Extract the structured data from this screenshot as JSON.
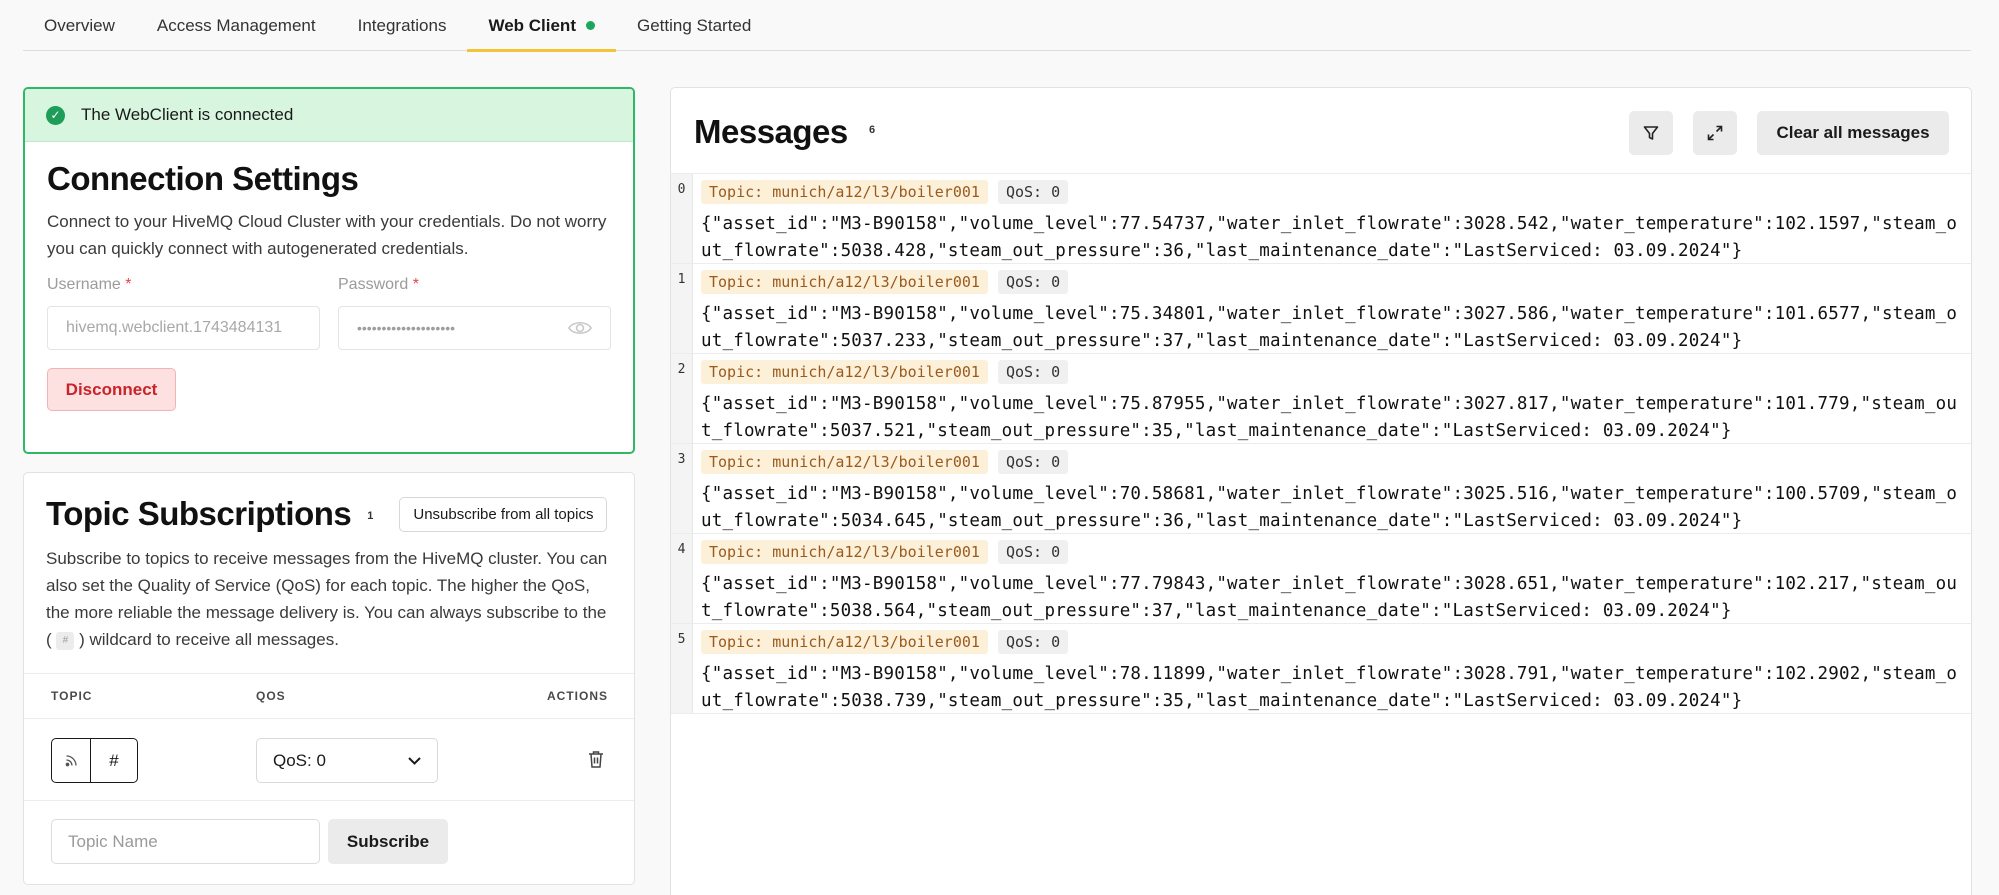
{
  "nav": {
    "tabs": [
      {
        "label": "Overview"
      },
      {
        "label": "Access Management"
      },
      {
        "label": "Integrations"
      },
      {
        "label": "Web Client"
      },
      {
        "label": "Getting Started"
      }
    ]
  },
  "connection": {
    "status": "The WebClient is connected",
    "title": "Connection Settings",
    "description": "Connect to your HiveMQ Cloud Cluster with your credentials. Do not worry you can quickly connect with autogenerated credentials.",
    "username_label": "Username",
    "password_label": "Password",
    "required_mark": "*",
    "username_value": "hivemq.webclient.1743484131",
    "password_value": "••••••••••••••••••••",
    "disconnect_label": "Disconnect"
  },
  "topics": {
    "title": "Topic Subscriptions",
    "count": "1",
    "unsubscribe_all": "Unsubscribe from all topics",
    "description_before": "Subscribe to topics to receive messages from the HiveMQ cluster. You can also set the Quality of Service (QoS) for each topic. The higher the QoS, the more reliable the message delivery is. You can always subscribe to the ( ",
    "wildcard": "#",
    "description_after": " ) wildcard to receive all messages.",
    "col_topic": "TOPIC",
    "col_qos": "QOS",
    "col_actions": "ACTIONS",
    "rows": [
      {
        "topic": "#",
        "qos": "QoS: 0"
      }
    ],
    "input_placeholder": "Topic Name",
    "subscribe_label": "Subscribe"
  },
  "messages": {
    "title": "Messages",
    "count": "6",
    "clear_label": "Clear all messages",
    "items": [
      {
        "index": "0",
        "topic": "Topic: munich/a12/l3/boiler001",
        "qos": "QoS: 0",
        "payload": "{\"asset_id\":\"M3-B90158\",\"volume_level\":77.54737,\"water_inlet_flowrate\":3028.542,\"water_temperature\":102.1597,\"steam_out_flowrate\":5038.428,\"steam_out_pressure\":36,\"last_maintenance_date\":\"LastServiced: 03.09.2024\"}"
      },
      {
        "index": "1",
        "topic": "Topic: munich/a12/l3/boiler001",
        "qos": "QoS: 0",
        "payload": "{\"asset_id\":\"M3-B90158\",\"volume_level\":75.34801,\"water_inlet_flowrate\":3027.586,\"water_temperature\":101.6577,\"steam_out_flowrate\":5037.233,\"steam_out_pressure\":37,\"last_maintenance_date\":\"LastServiced: 03.09.2024\"}"
      },
      {
        "index": "2",
        "topic": "Topic: munich/a12/l3/boiler001",
        "qos": "QoS: 0",
        "payload": "{\"asset_id\":\"M3-B90158\",\"volume_level\":75.87955,\"water_inlet_flowrate\":3027.817,\"water_temperature\":101.779,\"steam_out_flowrate\":5037.521,\"steam_out_pressure\":35,\"last_maintenance_date\":\"LastServiced: 03.09.2024\"}"
      },
      {
        "index": "3",
        "topic": "Topic: munich/a12/l3/boiler001",
        "qos": "QoS: 0",
        "payload": "{\"asset_id\":\"M3-B90158\",\"volume_level\":70.58681,\"water_inlet_flowrate\":3025.516,\"water_temperature\":100.5709,\"steam_out_flowrate\":5034.645,\"steam_out_pressure\":36,\"last_maintenance_date\":\"LastServiced: 03.09.2024\"}"
      },
      {
        "index": "4",
        "topic": "Topic: munich/a12/l3/boiler001",
        "qos": "QoS: 0",
        "payload": "{\"asset_id\":\"M3-B90158\",\"volume_level\":77.79843,\"water_inlet_flowrate\":3028.651,\"water_temperature\":102.217,\"steam_out_flowrate\":5038.564,\"steam_out_pressure\":37,\"last_maintenance_date\":\"LastServiced: 03.09.2024\"}"
      },
      {
        "index": "5",
        "topic": "Topic: munich/a12/l3/boiler001",
        "qos": "QoS: 0",
        "payload": "{\"asset_id\":\"M3-B90158\",\"volume_level\":78.11899,\"water_inlet_flowrate\":3028.791,\"water_temperature\":102.2902,\"steam_out_flowrate\":5038.739,\"steam_out_pressure\":35,\"last_maintenance_date\":\"LastServiced: 03.09.2024\"}"
      }
    ]
  },
  "icons": {
    "connected": "check-circle-icon",
    "password_toggle": "eye-icon",
    "topic_type": "rss-icon",
    "qos_dropdown": "chevron-down-icon",
    "delete": "trash-icon",
    "filter": "filter-icon",
    "expand": "expand-icon"
  },
  "colors": {
    "accent_tab": "#f3c438",
    "connected_green": "#2fb865",
    "live_dot": "#1da75c",
    "disconnect_red": "#c9232b",
    "topic_tag_bg": "#fdf0d9",
    "topic_tag_text": "#9a5a1e"
  }
}
